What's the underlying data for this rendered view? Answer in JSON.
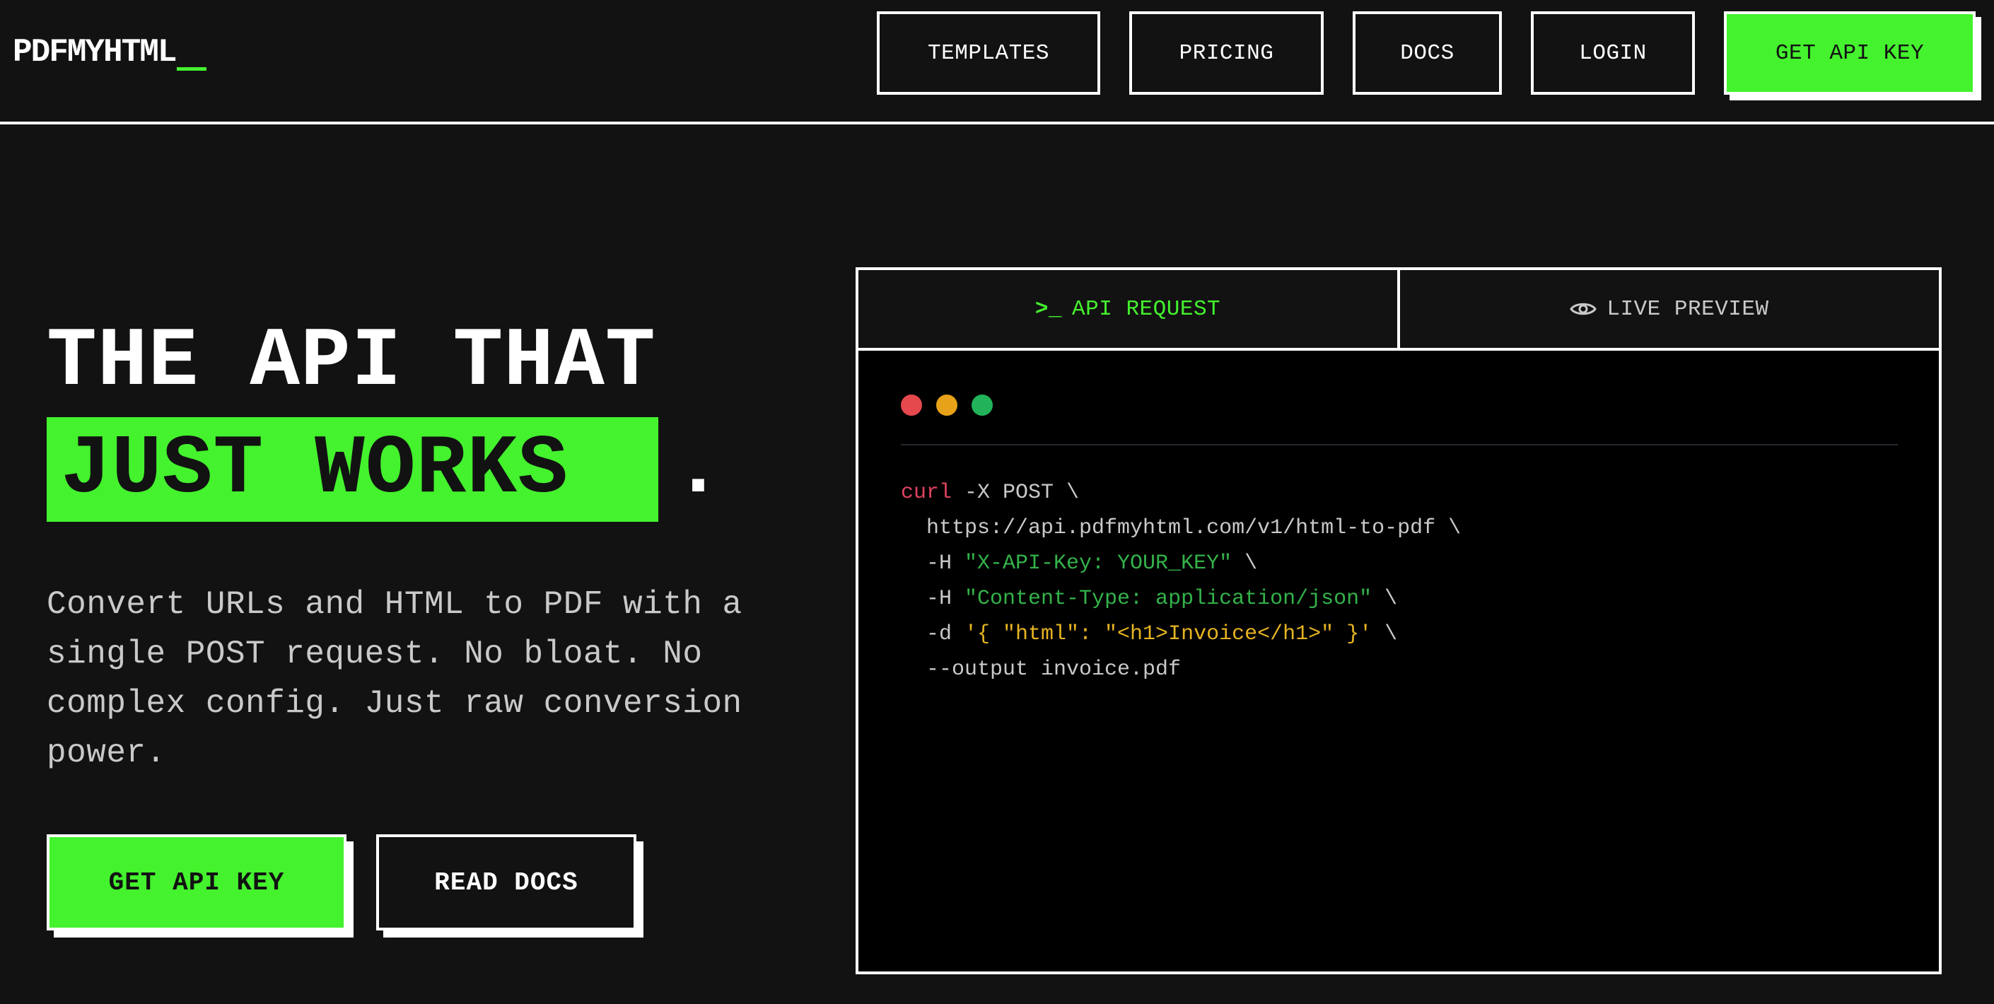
{
  "logo": {
    "text": "PDFMYHTML"
  },
  "nav": {
    "items": [
      {
        "label": "TEMPLATES"
      },
      {
        "label": "PRICING"
      },
      {
        "label": "DOCS"
      },
      {
        "label": "LOGIN"
      }
    ],
    "cta_label": "GET API KEY"
  },
  "hero": {
    "headline_line1": "THE API THAT",
    "headline_line2": "JUST WORKS",
    "headline_dot": ".",
    "subtext": "Convert URLs and HTML to PDF with a single POST request. No bloat. No complex config. Just raw conversion power.",
    "primary_button": "GET API KEY",
    "secondary_button": "READ DOCS"
  },
  "panel": {
    "tabs": [
      {
        "glyph": ">_",
        "label": "API REQUEST",
        "icon": "terminal-icon",
        "active": true
      },
      {
        "label": "LIVE PREVIEW",
        "icon": "eye-icon",
        "active": false
      }
    ],
    "window_dots": [
      "#e5484d",
      "#e8a21a",
      "#22b35a"
    ],
    "code": {
      "l1_cmd": "curl",
      "l1_rest": " -X POST \\",
      "l2": "  https://api.pdfmyhtml.com/v1/html-to-pdf \\",
      "l3_flag": "  -H ",
      "l3_str": "\"X-API-Key: YOUR_KEY\"",
      "l3_end": " \\",
      "l4_flag": "  -H ",
      "l4_str": "\"Content-Type: application/json\"",
      "l4_end": " \\",
      "l5_flag": "  -d ",
      "l5_body": "'{ \"html\": \"<h1>Invoice</h1>\" }'",
      "l5_end": " \\",
      "l6": "  --output invoice.pdf"
    }
  },
  "colors": {
    "accent": "#44f22e",
    "background": "#121212",
    "code_background": "#000000"
  }
}
